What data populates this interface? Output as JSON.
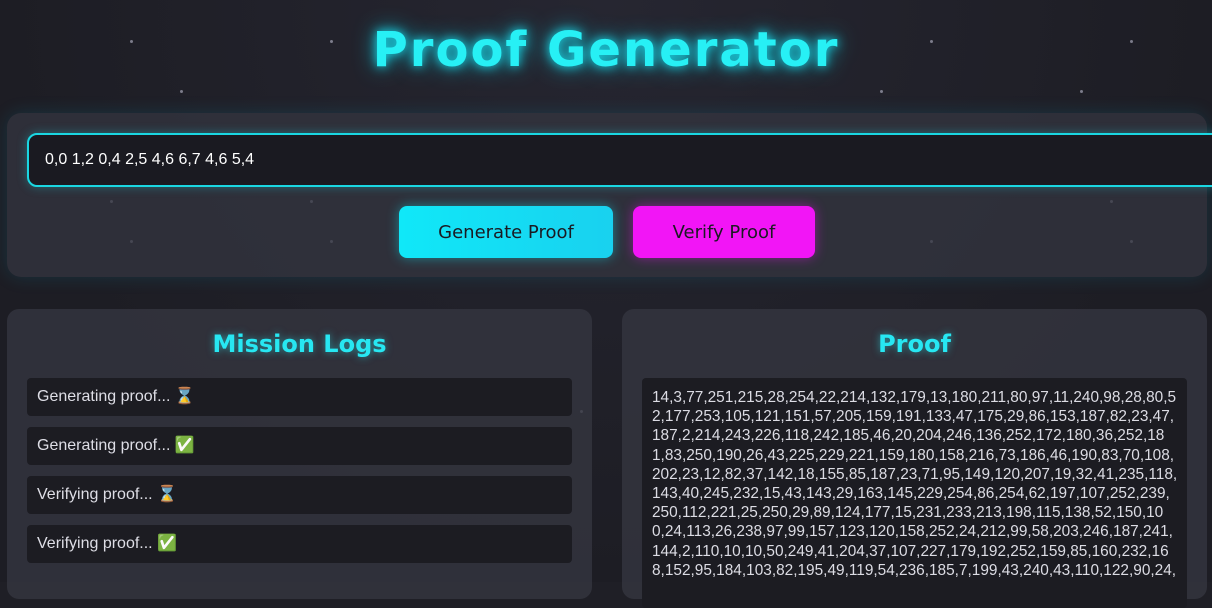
{
  "header": {
    "title": "Proof Generator"
  },
  "input": {
    "value": "0,0 1,2 0,4 2,5 4,6 6,7 4,6 5,4"
  },
  "buttons": {
    "generate": "Generate Proof",
    "verify": "Verify Proof"
  },
  "logs": {
    "title": "Mission Logs",
    "items": [
      "Generating proof... ⌛",
      "Generating proof... ✅",
      "Verifying proof... ⌛",
      "Verifying proof... ✅"
    ]
  },
  "proof": {
    "title": "Proof",
    "lines": [
      "14,3,77,251,215,28,254,22,214,132,179,13,180,211,80,97,11,240,98,28,80,5",
      "2,177,253,105,121,151,57,205,159,191,133,47,175,29,86,153,187,82,23,47,",
      "187,2,214,243,226,118,242,185,46,20,204,246,136,252,172,180,36,252,18",
      "1,83,250,190,26,43,225,229,221,159,180,158,216,73,186,46,190,83,70,108,",
      "202,23,12,82,37,142,18,155,85,187,23,71,95,149,120,207,19,32,41,235,118,",
      "143,40,245,232,15,43,143,29,163,145,229,254,86,254,62,197,107,252,239,",
      "250,112,221,25,250,29,89,124,177,15,231,233,213,198,115,138,52,150,10",
      "0,24,113,26,238,97,99,157,123,120,158,252,24,212,99,58,203,246,187,241,",
      "144,2,110,10,10,50,249,41,204,37,107,227,179,192,252,159,85,160,232,16",
      "8,152,95,184,103,82,195,49,119,54,236,185,7,199,43,240,43,110,122,90,24,"
    ]
  },
  "colors": {
    "accent_cyan": "#1ad7e2",
    "accent_magenta": "#f215f6",
    "background": "#1f1f26"
  }
}
